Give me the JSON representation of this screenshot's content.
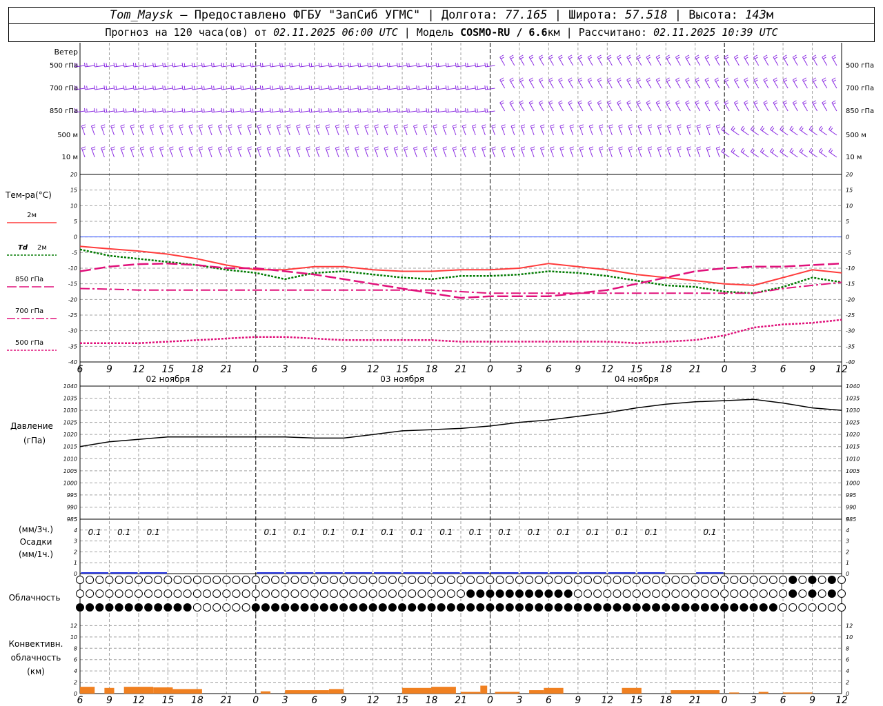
{
  "header": {
    "station": "Tom_Maysk",
    "provider_text": "– Предоставлено ФГБУ \"ЗапСиб УГМС\"",
    "lon_label": "Долгота:",
    "lon_value": "77.165",
    "lat_label": "Широта:",
    "lat_value": "57.518",
    "alt_label": "Высота:",
    "alt_value": "143",
    "alt_unit": "м",
    "forecast_prefix": "Прогноз на 120 часа(ов) от",
    "forecast_time": "02.11.2025 06:00 UTC",
    "model_label": "Модель",
    "model_name": "COSMO-RU / 6.6",
    "model_unit": "км",
    "calc_label": "Рассчитано:",
    "calc_time": "02.11.2025 10:39 UTC"
  },
  "colors": {
    "wind": "#8a2be2",
    "t2m": "#ff3b3b",
    "td2m": "#007a00",
    "t850": "#e0107a",
    "t700": "#e0107a",
    "t500": "#e0107a",
    "zero_line": "#3050ff",
    "pressure": "#000000",
    "precip": "#2030e0",
    "convective": "#f08020",
    "grid": "#a0a0a0"
  },
  "time_axis": {
    "hour_labels": [
      "6",
      "9",
      "12",
      "15",
      "18",
      "21",
      "0",
      "3",
      "6",
      "9",
      "12",
      "15",
      "18",
      "21",
      "0",
      "3",
      "6",
      "9",
      "12",
      "15",
      "18",
      "21",
      "0",
      "3",
      "6",
      "9",
      "12"
    ],
    "date_labels": [
      "02 ноября",
      "03 ноября",
      "04 ноября"
    ]
  },
  "wind_panel": {
    "title": "Ветер",
    "levels_left": [
      "500 гПа",
      "700 гПа",
      "850 гПа",
      "500 м",
      "10 м"
    ],
    "levels_right": [
      "500 гПа",
      "700 гПа",
      "850 гПа",
      "500 м",
      "10 м"
    ]
  },
  "temp_panel": {
    "title": "Тем-ра(°С)",
    "legend": {
      "t2m": "2м",
      "td_prefix": "Td",
      "td": "2м",
      "t850": "850 гПа",
      "t700": "700 гПа",
      "t500": "500 гПа"
    }
  },
  "pressure_panel": {
    "title1": "Давление",
    "title2": "(гПа)"
  },
  "precip_panel": {
    "title1": "(мм/3ч.)",
    "title2": "Осадки",
    "title3": "(мм/1ч.)"
  },
  "cloud_panel": {
    "title": "Облачность"
  },
  "conv_panel": {
    "title1": "Конвективн.",
    "title2": "облачность",
    "title3": "(км)"
  },
  "chart_data": [
    {
      "type": "line",
      "panel": "temperature",
      "ylim": [
        -40,
        20
      ],
      "yticks": [
        20,
        15,
        10,
        5,
        0,
        -5,
        -10,
        -15,
        -20,
        -25,
        -30,
        -35,
        -40
      ],
      "x_hours": [
        0,
        3,
        6,
        9,
        12,
        15,
        18,
        21,
        24,
        27,
        30,
        33,
        36,
        39,
        42,
        45,
        48,
        51,
        54,
        57,
        60,
        63,
        66,
        69,
        72,
        75,
        78
      ],
      "series": [
        {
          "key": "t2m",
          "name": "2м",
          "values": [
            -3,
            -3.8,
            -4.5,
            -5.5,
            -7,
            -9,
            -10.5,
            -10.5,
            -9.5,
            -9.5,
            -10.5,
            -11,
            -11,
            -10.5,
            -10.5,
            -10,
            -8.5,
            -9.5,
            -10.5,
            -12,
            -13,
            -14,
            -15,
            -15.5,
            -13,
            -10.5,
            -11.5
          ]
        },
        {
          "key": "td2m",
          "name": "Td 2м",
          "values": [
            -4,
            -6,
            -7,
            -8,
            -9,
            -10.5,
            -11.5,
            -13.5,
            -11.5,
            -11,
            -12,
            -13,
            -13.5,
            -12.5,
            -12.5,
            -12,
            -11,
            -11.5,
            -12.5,
            -14,
            -15.5,
            -16,
            -17.5,
            -18,
            -16,
            -13,
            -14.5
          ]
        },
        {
          "key": "t850",
          "name": "850 гПа",
          "values": [
            -11,
            -9.5,
            -8.7,
            -8.5,
            -9,
            -10,
            -10,
            -11,
            -12,
            -13.5,
            -15,
            -16.5,
            -18,
            -19.5,
            -19,
            -19,
            -19,
            -18,
            -17,
            -15,
            -13,
            -11,
            -10,
            -9.5,
            -9.5,
            -9,
            -8.5
          ]
        },
        {
          "key": "t700",
          "name": "700 гПа",
          "values": [
            -16.5,
            -16.7,
            -17,
            -17,
            -17,
            -17,
            -17,
            -17,
            -17,
            -17,
            -17,
            -17,
            -17,
            -17.5,
            -18,
            -18,
            -18,
            -18,
            -18,
            -18,
            -18,
            -18,
            -18,
            -18,
            -16.5,
            -15.5,
            -14.5
          ]
        },
        {
          "key": "t500",
          "name": "500 гПа",
          "values": [
            -34,
            -34,
            -34,
            -33.5,
            -33,
            -32.5,
            -32,
            -32,
            -32.5,
            -33,
            -33,
            -33,
            -33,
            -33.5,
            -33.5,
            -33.5,
            -33.5,
            -33.5,
            -33.5,
            -34,
            -33.5,
            -33,
            -31.5,
            -29,
            -28,
            -27.5,
            -26.5
          ]
        }
      ]
    },
    {
      "type": "line",
      "panel": "pressure",
      "ylim": [
        985,
        1040
      ],
      "yticks": [
        1040,
        1035,
        1030,
        1025,
        1020,
        1015,
        1010,
        1005,
        1000,
        995,
        990,
        985
      ],
      "x_hours": [
        0,
        3,
        6,
        9,
        12,
        15,
        18,
        21,
        24,
        27,
        30,
        33,
        36,
        39,
        42,
        45,
        48,
        51,
        54,
        57,
        60,
        63,
        66,
        69,
        72,
        75,
        78
      ],
      "series": [
        {
          "key": "pressure",
          "name": "Давление",
          "values": [
            1015,
            1017,
            1018,
            1019,
            1019,
            1019,
            1019,
            1019,
            1018.5,
            1018.5,
            1020,
            1021.5,
            1022,
            1022.5,
            1023.5,
            1025,
            1026,
            1027.5,
            1029,
            1031,
            1032.5,
            1033.5,
            1034,
            1034.5,
            1033,
            1031,
            1030
          ]
        }
      ]
    },
    {
      "type": "bar",
      "panel": "precipitation",
      "ylim": [
        0,
        5
      ],
      "yticks": [
        5,
        4,
        3,
        2,
        1,
        0
      ],
      "labels": [
        {
          "hour": 1.5,
          "text": "0.1"
        },
        {
          "hour": 4.5,
          "text": "0.1"
        },
        {
          "hour": 7.5,
          "text": "0.1"
        },
        {
          "hour": 19.5,
          "text": "0.1"
        },
        {
          "hour": 22.5,
          "text": "0.1"
        },
        {
          "hour": 25.5,
          "text": "0.1"
        },
        {
          "hour": 28.5,
          "text": "0.1"
        },
        {
          "hour": 31.5,
          "text": "0.1"
        },
        {
          "hour": 34.5,
          "text": "0.1"
        },
        {
          "hour": 37.5,
          "text": "0.1"
        },
        {
          "hour": 40.5,
          "text": "0.1"
        },
        {
          "hour": 43.5,
          "text": "0.1"
        },
        {
          "hour": 46.5,
          "text": "0.1"
        },
        {
          "hour": 49.5,
          "text": "0.1"
        },
        {
          "hour": 52.5,
          "text": "0.1"
        },
        {
          "hour": 55.5,
          "text": "0.1"
        },
        {
          "hour": 58.5,
          "text": "0.1"
        },
        {
          "hour": 64.5,
          "text": "0.1"
        }
      ]
    },
    {
      "type": "bar",
      "panel": "convective_clouds",
      "ylim": [
        0,
        14
      ],
      "yticks": [
        12,
        10,
        8,
        6,
        4,
        2,
        0
      ],
      "bars": [
        {
          "h0": 0,
          "h1": 1.5,
          "value": 1.2
        },
        {
          "h0": 2.5,
          "h1": 3.5,
          "value": 1.0
        },
        {
          "h0": 4.5,
          "h1": 7.5,
          "value": 1.2
        },
        {
          "h0": 7.5,
          "h1": 9.5,
          "value": 1.1
        },
        {
          "h0": 9.5,
          "h1": 12.5,
          "value": 0.8
        },
        {
          "h0": 18.5,
          "h1": 19.5,
          "value": 0.4
        },
        {
          "h0": 21,
          "h1": 25.5,
          "value": 0.6
        },
        {
          "h0": 25.5,
          "h1": 27,
          "value": 0.8
        },
        {
          "h0": 33,
          "h1": 36,
          "value": 1.0
        },
        {
          "h0": 36,
          "h1": 38.5,
          "value": 1.2
        },
        {
          "h0": 39,
          "h1": 41,
          "value": 0.3
        },
        {
          "h0": 41,
          "h1": 41.7,
          "value": 1.4
        },
        {
          "h0": 42.5,
          "h1": 45,
          "value": 0.3
        },
        {
          "h0": 46,
          "h1": 47.5,
          "value": 0.6
        },
        {
          "h0": 47.5,
          "h1": 49.5,
          "value": 1.0
        },
        {
          "h0": 55.5,
          "h1": 57.5,
          "value": 1.0
        },
        {
          "h0": 60.5,
          "h1": 65.5,
          "value": 0.6
        },
        {
          "h0": 66.5,
          "h1": 67.5,
          "value": 0.2
        },
        {
          "h0": 69.5,
          "h1": 70.5,
          "value": 0.3
        },
        {
          "h0": 72,
          "h1": 75,
          "value": 0.2
        }
      ]
    }
  ]
}
